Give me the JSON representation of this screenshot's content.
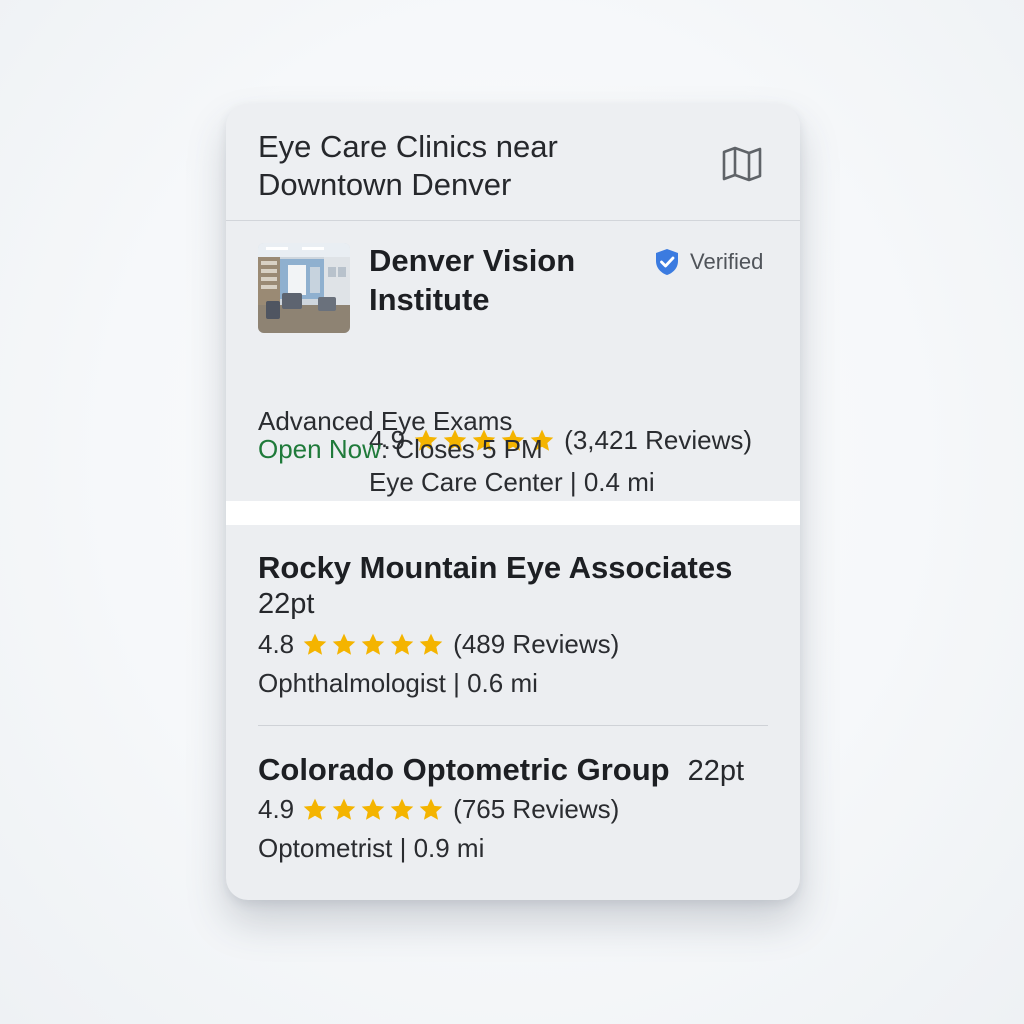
{
  "header": {
    "title": "Eye Care Clinics near Downtown Denver",
    "map_icon": "map-icon"
  },
  "featured": {
    "name": "Denver Vision Institute",
    "verified_label": "Verified",
    "rating": "4.9",
    "stars": 5,
    "reviews": "(3,421 Reviews)",
    "category_distance": "Eye Care Center | 0.4 mi",
    "service": "Advanced Eye Exams",
    "status_open": "Open Now",
    "status_hours": ": Closes 5 PM"
  },
  "listings": [
    {
      "name": "Rocky Mountain Eye Associates",
      "size_tag": "22pt",
      "rating": "4.8",
      "stars": 5,
      "reviews": "(489 Reviews)",
      "category_distance": "Ophthalmologist | 0.6 mi"
    },
    {
      "name": "Colorado Optometric Group",
      "size_tag": "22pt",
      "rating": "4.9",
      "stars": 5,
      "reviews": "(765 Reviews)",
      "category_distance": "Optometrist | 0.9 mi"
    }
  ],
  "colors": {
    "star": "#f4b400",
    "verified_badge": "#3b7be0",
    "open_status": "#1f7a3a"
  }
}
